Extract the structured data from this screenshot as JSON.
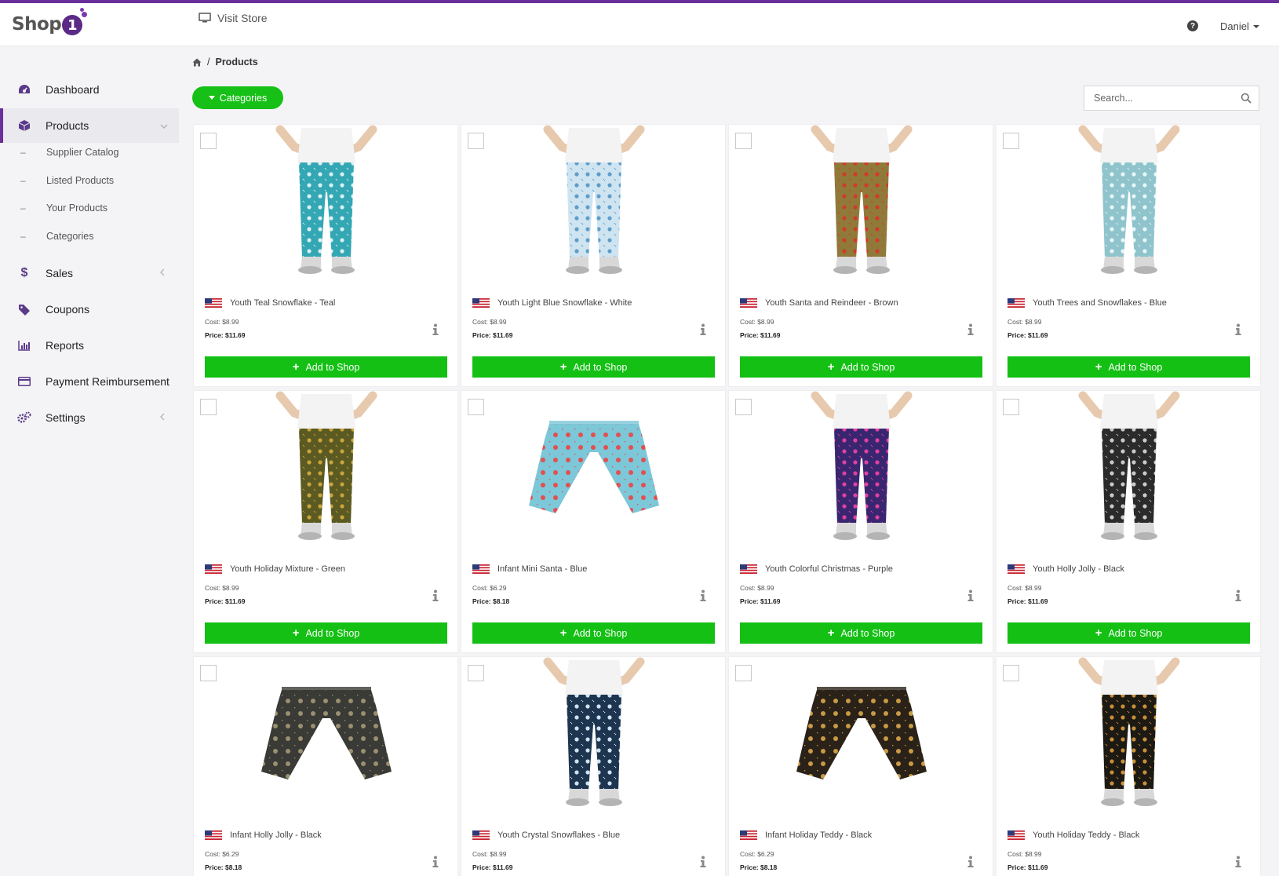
{
  "header": {
    "logo_text": "Shop",
    "logo_badge": "1",
    "visit_store": "Visit Store",
    "user_name": "Daniel",
    "help_glyph": "?"
  },
  "sidebar": {
    "items": [
      {
        "label": "Dashboard",
        "icon": "dashboard-icon"
      },
      {
        "label": "Products",
        "icon": "box-icon",
        "active": true
      },
      {
        "label": "Sales",
        "icon": "dollar-icon"
      },
      {
        "label": "Coupons",
        "icon": "tag-icon"
      },
      {
        "label": "Reports",
        "icon": "bar-chart-icon"
      },
      {
        "label": "Payment Reimbursement",
        "icon": "credit-card-icon"
      },
      {
        "label": "Settings",
        "icon": "gears-icon"
      }
    ],
    "sub_items": [
      "Supplier Catalog",
      "Listed Products",
      "Your Products",
      "Categories"
    ]
  },
  "breadcrumb": {
    "current": "Products"
  },
  "toolbar": {
    "categories_label": "Categories",
    "search_placeholder": "Search..."
  },
  "products": [
    {
      "title": "Youth Teal Snowflake - Teal",
      "cost": "Cost: $8.99",
      "price": "Price: $11.69",
      "type": "youth",
      "colors": [
        "#34a7b4",
        "#d8f0f2"
      ]
    },
    {
      "title": "Youth Light Blue Snowflake - White",
      "cost": "Cost: $8.99",
      "price": "Price: $11.69",
      "type": "youth",
      "colors": [
        "#cfe4f1",
        "#5f9ec9"
      ]
    },
    {
      "title": "Youth Santa and Reindeer - Brown",
      "cost": "Cost: $8.99",
      "price": "Price: $11.69",
      "type": "youth",
      "colors": [
        "#8f7a3a",
        "#d23a2a"
      ]
    },
    {
      "title": "Youth Trees and Snowflakes - Blue",
      "cost": "Cost: $8.99",
      "price": "Price: $11.69",
      "type": "youth",
      "colors": [
        "#8fc4cc",
        "#e8f6f7"
      ]
    },
    {
      "title": "Youth Holiday Mixture - Green",
      "cost": "Cost: $8.99",
      "price": "Price: $11.69",
      "type": "youth",
      "colors": [
        "#5b5a22",
        "#c9a43a"
      ]
    },
    {
      "title": "Infant Mini Santa - Blue",
      "cost": "Cost: $6.29",
      "price": "Price: $8.18",
      "type": "infant",
      "colors": [
        "#7cc7d8",
        "#e25050"
      ]
    },
    {
      "title": "Youth Colorful Christmas - Purple",
      "cost": "Cost: $8.99",
      "price": "Price: $11.69",
      "type": "youth",
      "colors": [
        "#3a2670",
        "#e040a0"
      ]
    },
    {
      "title": "Youth Holly Jolly - Black",
      "cost": "Cost: $8.99",
      "price": "Price: $11.69",
      "type": "youth",
      "colors": [
        "#2b2b2b",
        "#c9c9c9"
      ]
    },
    {
      "title": "Infant Holly Jolly - Black",
      "cost": "Cost: $6.29",
      "price": "Price: $8.18",
      "type": "infant",
      "colors": [
        "#3a3a36",
        "#9a8f70"
      ]
    },
    {
      "title": "Youth Crystal Snowflakes - Blue",
      "cost": "Cost: $8.99",
      "price": "Price: $11.69",
      "type": "youth",
      "colors": [
        "#1e3550",
        "#cfe2f2"
      ]
    },
    {
      "title": "Infant Holiday Teddy - Black",
      "cost": "Cost: $6.29",
      "price": "Price: $8.18",
      "type": "infant",
      "colors": [
        "#2a2218",
        "#c99a45"
      ]
    },
    {
      "title": "Youth Holiday Teddy - Black",
      "cost": "Cost: $8.99",
      "price": "Price: $11.69",
      "type": "youth",
      "colors": [
        "#1d1a14",
        "#c98e3a"
      ]
    }
  ],
  "card_labels": {
    "add_to_shop": "Add to Shop"
  },
  "colors": {
    "brand": "#6a2f9b",
    "accent_green": "#13c013"
  }
}
